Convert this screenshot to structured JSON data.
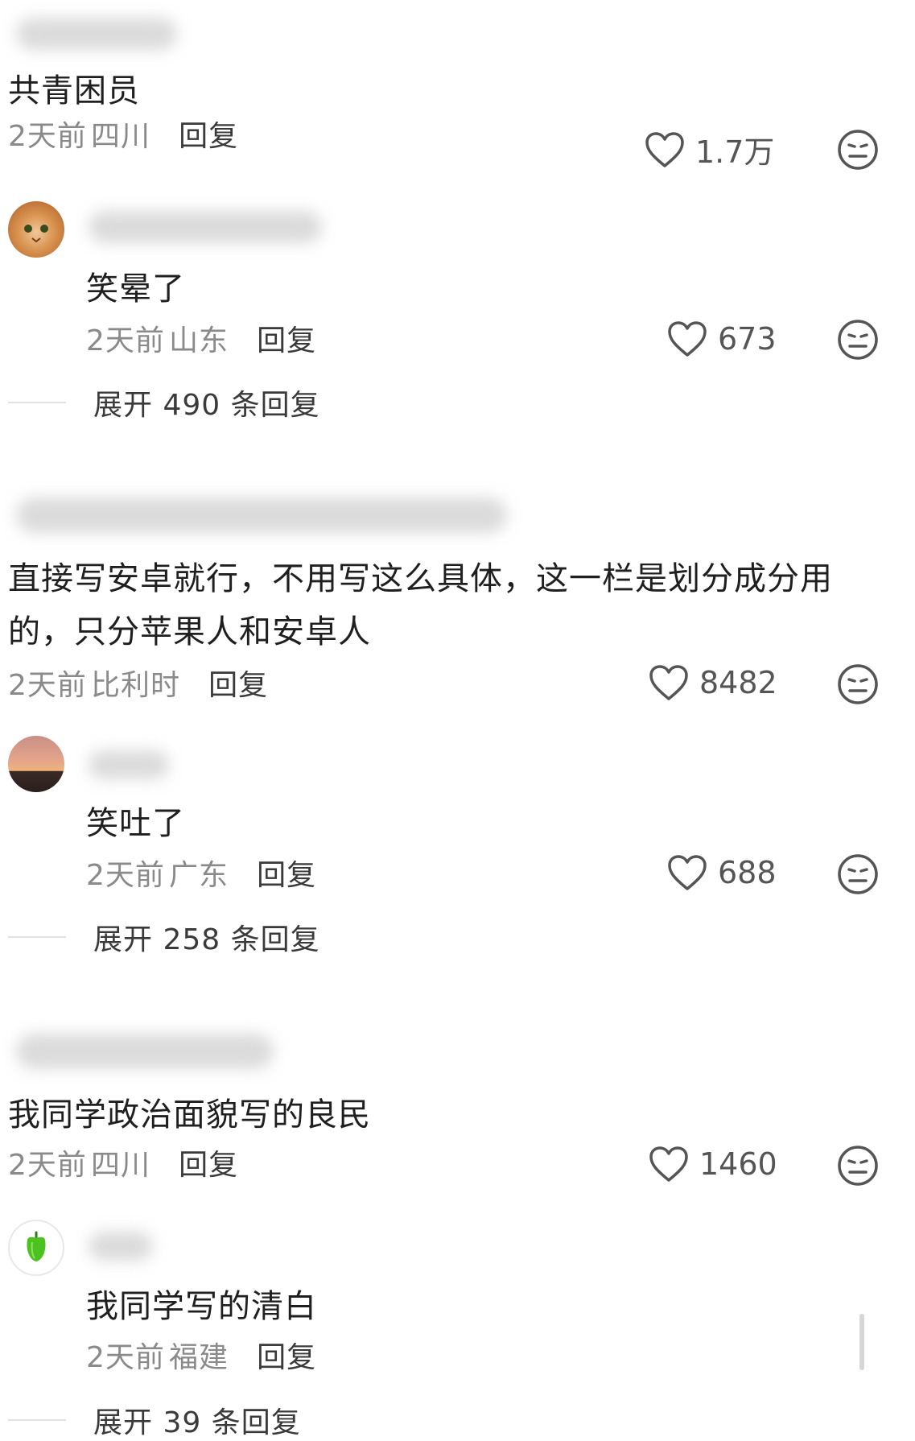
{
  "comments": [
    {
      "text": "共青困员",
      "time": "2天前",
      "location": "四川",
      "reply_label": "回复",
      "likes": "1.7万",
      "replies": [
        {
          "text": "笑晕了",
          "time": "2天前",
          "location": "山东",
          "reply_label": "回复",
          "likes": "673",
          "avatar_icon": "cat-avatar-icon"
        }
      ],
      "expand_label": "展开 490 条回复"
    },
    {
      "text_line1": "直接写安卓就行，不用写这么具体，这一栏是划分成分用",
      "text_line2": "的，只分苹果人和安卓人",
      "time": "2天前",
      "location": "比利时",
      "reply_label": "回复",
      "likes": "8482",
      "replies": [
        {
          "text": "笑吐了",
          "time": "2天前",
          "location": "广东",
          "reply_label": "回复",
          "likes": "688",
          "avatar_icon": "sunset-avatar-icon"
        }
      ],
      "expand_label": "展开 258 条回复"
    },
    {
      "text": "我同学政治面貌写的良民",
      "time": "2天前",
      "location": "四川",
      "reply_label": "回复",
      "likes": "1460",
      "replies": [
        {
          "text": "我同学写的清白",
          "time": "2天前",
          "location": "福建",
          "reply_label": "回复",
          "avatar_icon": "pepper-avatar-icon"
        }
      ],
      "expand_label": "展开 39 条回复"
    }
  ],
  "icons": {
    "like": "heart-outline-icon",
    "dislike": "meh-face-icon"
  },
  "colors": {
    "text": "#1f1f1f",
    "meta": "#8a8a8a",
    "icon": "#555555"
  }
}
